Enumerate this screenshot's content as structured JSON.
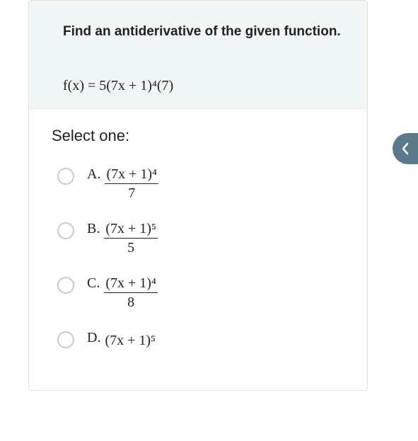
{
  "question": {
    "prompt": "Find an antiderivative of the given function.",
    "formula": "f(x) = 5(7x + 1)⁴(7)"
  },
  "select_label": "Select one:",
  "options": {
    "a": {
      "letter": "A.",
      "numerator": "(7x + 1)⁴",
      "denominator": "7"
    },
    "b": {
      "letter": "B.",
      "numerator": "(7x + 1)⁵",
      "denominator": "5"
    },
    "c": {
      "letter": "C.",
      "numerator": "(7x + 1)⁴",
      "denominator": "8"
    },
    "d": {
      "letter": "D.",
      "expression": "(7x + 1)⁵"
    }
  }
}
